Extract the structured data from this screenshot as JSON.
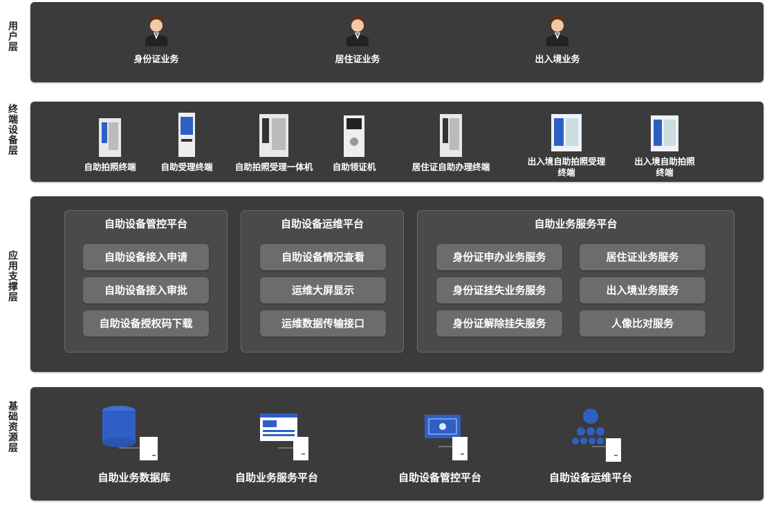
{
  "layers": {
    "user_label": "用户层",
    "terminal_label": "终端设备层",
    "app_label": "应用支撑层",
    "base_label": "基础资源层"
  },
  "users": [
    "身份证业务",
    "居住证业务",
    "出入境业务"
  ],
  "terminals": [
    {
      "line1": "自助拍照终端",
      "line2": ""
    },
    {
      "line1": "自助受理终端",
      "line2": ""
    },
    {
      "line1": "自助拍照受理一体机",
      "line2": ""
    },
    {
      "line1": "自助领证机",
      "line2": ""
    },
    {
      "line1": "居住证自助办理终端",
      "line2": ""
    },
    {
      "line1": "出入境自助拍照受理",
      "line2": "终端"
    },
    {
      "line1": "出入境自助拍照",
      "line2": "终端"
    }
  ],
  "platforms": {
    "mgmt": {
      "title": "自助设备管控平台",
      "items": [
        "自助设备接入申请",
        "自助设备接入审批",
        "自助设备授权码下载"
      ]
    },
    "ops": {
      "title": "自助设备运维平台",
      "items": [
        "自助设备情况查看",
        "运维大屏显示",
        "运维数据传输接口"
      ]
    },
    "biz": {
      "title": "自助业务服务平台",
      "items": [
        "身份证申办业务服务",
        "居住证业务服务",
        "身份证挂失业务服务",
        "出入境业务服务",
        "身份证解除挂失服务",
        "人像比对服务"
      ]
    }
  },
  "resources": [
    "自助业务数据库",
    "自助业务服务平台",
    "自助设备管控平台",
    "自助设备运维平台"
  ],
  "colors": {
    "band": "#3b3b3b",
    "panel": "#4a4a4a",
    "pill": "#6c6c6c",
    "accent": "#2f5fc4"
  }
}
